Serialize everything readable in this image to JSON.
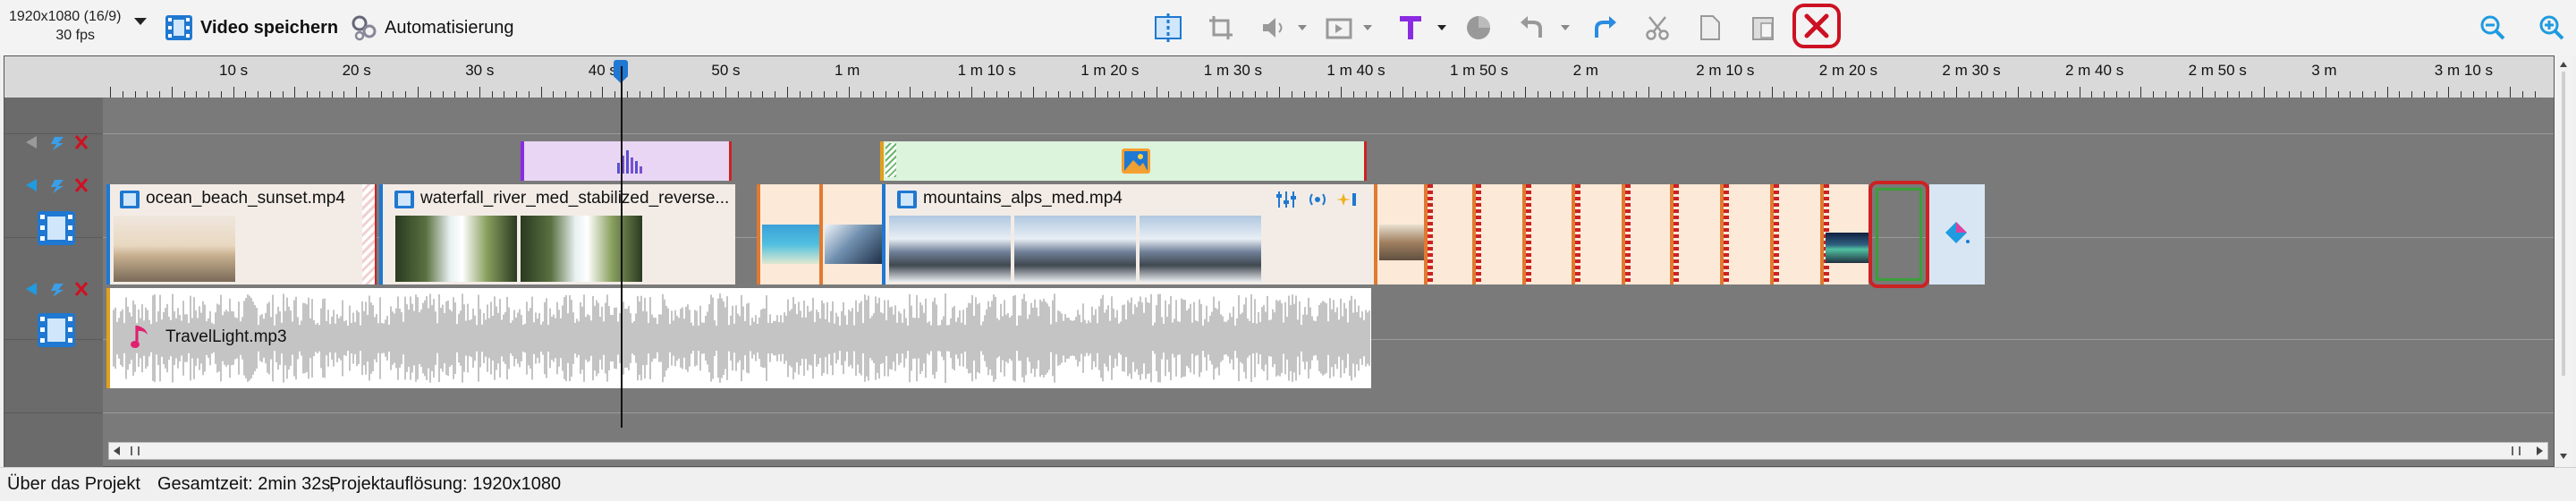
{
  "toolbar": {
    "resolution_line1": "1920x1080 (16/9)",
    "resolution_line2": "30 fps",
    "save_video_label": "Video speichern",
    "automation_label": "Automatisierung"
  },
  "icons": {
    "save_video": "film-save-icon",
    "automation": "gears-icon",
    "split": "split-icon",
    "crop": "crop-icon",
    "volume": "volume-icon",
    "transition": "transition-icon",
    "text": "text-T-icon",
    "color": "color-circle-icon",
    "undo": "undo-icon",
    "redo": "redo-icon",
    "cut": "scissors-icon",
    "copy": "copy-icon",
    "paste": "paste-icon",
    "delete": "delete-x-icon",
    "zoom_out": "zoom-out-icon",
    "zoom_in": "zoom-in-icon"
  },
  "colors": {
    "accent": "#1f78d1",
    "delete_red": "#cc1122",
    "text_purple": "#8a2be2",
    "redo_blue": "#2a8be0"
  },
  "ruler": {
    "labels": [
      "10 s",
      "20 s",
      "30 s",
      "40 s",
      "50 s",
      "1 m",
      "1 m 10 s",
      "1 m 20 s",
      "1 m 30 s",
      "1 m 40 s",
      "1 m 50 s",
      "2 m",
      "2 m 10 s",
      "2 m 20 s",
      "2 m 30 s",
      "2 m 40 s",
      "2 m 50 s",
      "3 m",
      "3 m 10 s"
    ]
  },
  "tracks": {
    "video_clips": [
      {
        "name": "ocean_beach_sunset.mp4"
      },
      {
        "name": "waterfall_river_med_stabilized_reverse..."
      },
      {
        "name": "mountains_alps_med.mp4"
      }
    ],
    "audio_clip": {
      "name": "TravelLight.mp3"
    }
  },
  "status": {
    "about": "Über das Projekt",
    "total_time": "Gesamtzeit: 2min 32s,",
    "resolution": "Projektauflösung:   1920x1080"
  }
}
